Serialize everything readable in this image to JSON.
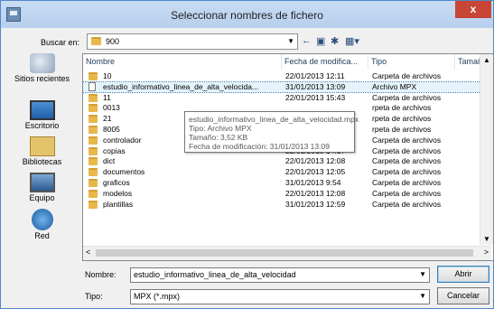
{
  "window": {
    "title": "Seleccionar nombres de fichero",
    "close_label": "x"
  },
  "look_in": {
    "label": "Buscar en:",
    "value": "900"
  },
  "places": [
    {
      "name": "recent",
      "label": "Sitios recientes"
    },
    {
      "name": "desktop",
      "label": "Escritorio"
    },
    {
      "name": "libraries",
      "label": "Bibliotecas"
    },
    {
      "name": "computer",
      "label": "Equipo"
    },
    {
      "name": "network",
      "label": "Red"
    }
  ],
  "columns": {
    "name": "Nombre",
    "date": "Fecha de modifica...",
    "type": "Tipo",
    "size": "Tamaño"
  },
  "rows": [
    {
      "name": "10",
      "date": "22/01/2013 12:11",
      "type": "Carpeta de archivos",
      "kind": "folder"
    },
    {
      "name": "estudio_informativo_linea_de_alta_velocida...",
      "date": "31/01/2013 13:09",
      "type": "Archivo MPX",
      "kind": "file"
    },
    {
      "name": "11",
      "date": "22/01/2013 15:43",
      "type": "Carpeta de archivos",
      "kind": "folder"
    },
    {
      "name": "0013",
      "date": "",
      "type": "rpeta de archivos",
      "kind": "folder"
    },
    {
      "name": "21",
      "date": "",
      "type": "rpeta de archivos",
      "kind": "folder"
    },
    {
      "name": "8005",
      "date": "",
      "type": "rpeta de archivos",
      "kind": "folder"
    },
    {
      "name": "controlador",
      "date": "22/01/2013 12:08",
      "type": "Carpeta de archivos",
      "kind": "folder"
    },
    {
      "name": "copias",
      "date": "22/01/2013 14:17",
      "type": "Carpeta de archivos",
      "kind": "folder"
    },
    {
      "name": "dict",
      "date": "22/01/2013 12:08",
      "type": "Carpeta de archivos",
      "kind": "folder"
    },
    {
      "name": "documentos",
      "date": "22/01/2013 12:05",
      "type": "Carpeta de archivos",
      "kind": "folder"
    },
    {
      "name": "graficos",
      "date": "31/01/2013 9:54",
      "type": "Carpeta de archivos",
      "kind": "folder"
    },
    {
      "name": "modelos",
      "date": "22/01/2013 12:08",
      "type": "Carpeta de archivos",
      "kind": "folder"
    },
    {
      "name": "plantillas",
      "date": "31/01/2013 12:59",
      "type": "Carpeta de archivos",
      "kind": "folder"
    }
  ],
  "tooltip": {
    "line1": "estudio_informativo_linea_de_alta_velocidad.mpx",
    "line2": "Tipo: Archivo MPX",
    "line3": "Tamaño: 3,52 KB",
    "line4": "Fecha de modificación: 31/01/2013 13:09"
  },
  "filename": {
    "label": "Nombre:",
    "value": "estudio_informativo_linea_de_alta_velocidad"
  },
  "filetype": {
    "label": "Tipo:",
    "value": "MPX (*.mpx)"
  },
  "buttons": {
    "open": "Abrir",
    "cancel": "Cancelar"
  },
  "icons": [
    "back-icon",
    "up-folder-icon",
    "new-folder-icon",
    "view-menu-icon"
  ]
}
